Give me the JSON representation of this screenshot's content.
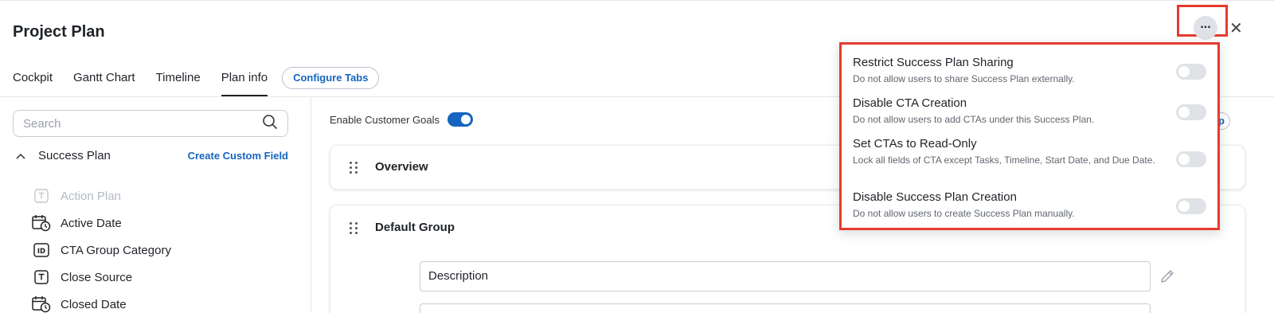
{
  "header": {
    "title": "Project Plan"
  },
  "tabs": [
    {
      "label": "Cockpit"
    },
    {
      "label": "Gantt Chart"
    },
    {
      "label": "Timeline"
    },
    {
      "label": "Plan info",
      "active": true
    }
  ],
  "configure_tabs_label": "Configure Tabs",
  "sidebar": {
    "search_placeholder": "Search",
    "section_label": "Success Plan",
    "create_custom_field_label": "Create Custom Field",
    "fields": [
      {
        "label": "Action Plan",
        "icon": "text-field-icon",
        "disabled": true
      },
      {
        "label": "Active Date",
        "icon": "calendar-clock-icon"
      },
      {
        "label": "CTA Group Category",
        "icon": "id-icon"
      },
      {
        "label": "Close Source",
        "icon": "text-field-icon"
      },
      {
        "label": "Closed Date",
        "icon": "calendar-clock-icon"
      }
    ]
  },
  "main": {
    "enable_goals_label": "Enable Customer Goals",
    "enable_goals_on": true,
    "help_fragment": "p",
    "overview_title": "Overview",
    "group_title": "Default Group",
    "description_label": "Description"
  },
  "more_button_label": "...",
  "close_label": "✕",
  "menu": {
    "items": [
      {
        "title": "Restrict Success Plan Sharing",
        "desc": "Do not allow users to share Success Plan externally.",
        "on": false
      },
      {
        "title": "Disable CTA Creation",
        "desc": "Do not allow users to add CTAs under this Success Plan.",
        "on": false
      },
      {
        "title": "Set CTAs to Read-Only",
        "desc": "Lock all fields of CTA except Tasks, Timeline, Start Date, and Due Date.",
        "on": false
      },
      {
        "title": "Disable Success Plan Creation",
        "desc": "Do not allow users to create Success Plan manually.",
        "on": false
      }
    ]
  },
  "colors": {
    "accent": "#1565c0",
    "highlight": "#e53b2c"
  }
}
